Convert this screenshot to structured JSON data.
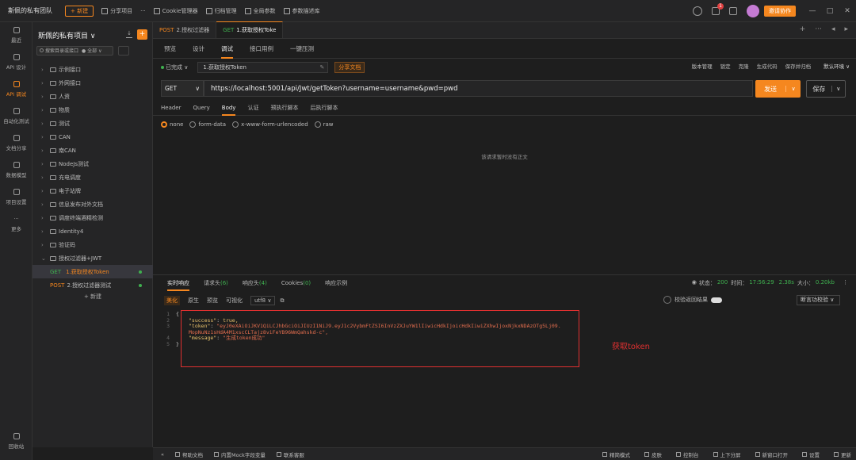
{
  "topbar": {
    "team": "斯佩的私有团队",
    "new_button": "+ 新建",
    "share_project": "分享项目",
    "more": "···",
    "cookie_manager": "Cookie管理器",
    "archive": "归档管理",
    "global_params": "全局参数",
    "param_library": "参数描述库",
    "badge_count": "1",
    "collab": "邀请协作",
    "win_min": "—",
    "win_max": "□",
    "win_close": "✕"
  },
  "rail": [
    {
      "label": "最近",
      "icon": "clock-icon"
    },
    {
      "label": "API 设计",
      "icon": "api-design-icon"
    },
    {
      "label": "API 调试",
      "icon": "api-debug-icon",
      "active": true
    },
    {
      "label": "自动化测试",
      "icon": "automation-icon"
    },
    {
      "label": "文档分享",
      "icon": "doc-share-icon"
    },
    {
      "label": "数据模型",
      "icon": "data-model-icon"
    },
    {
      "label": "项目设置",
      "icon": "settings-icon"
    },
    {
      "label": "更多",
      "icon": "more-icon"
    }
  ],
  "rail_bottom": "回收站",
  "sidebar": {
    "project_title": "斯佩的私有项目 ∨",
    "search_placeholder": "搜索目录或接口",
    "filter": "● 全部 ∨",
    "tree": [
      {
        "label": "示例接口",
        "expanded": false
      },
      {
        "label": "外网接口",
        "expanded": false
      },
      {
        "label": "人资",
        "expanded": false
      },
      {
        "label": "物质",
        "expanded": false
      },
      {
        "label": "测试",
        "expanded": false
      },
      {
        "label": "CAN",
        "expanded": false
      },
      {
        "label": "南CAN",
        "expanded": false
      },
      {
        "label": "NodeJs测试",
        "expanded": false
      },
      {
        "label": "充电调度",
        "expanded": false
      },
      {
        "label": "电子站牌",
        "expanded": false
      },
      {
        "label": "信息发布对外文档",
        "expanded": false
      },
      {
        "label": "调度终端酒精检测",
        "expanded": false
      },
      {
        "label": "Identity4",
        "expanded": false
      },
      {
        "label": "验证码",
        "expanded": false
      },
      {
        "label": "授权过滤器+JWT",
        "expanded": true
      }
    ],
    "children": [
      {
        "method": "GET",
        "label": "1.获取授权Token",
        "active": true
      },
      {
        "method": "POST",
        "label": "2.授权过滤器测试",
        "active": false
      }
    ],
    "add_label": "+ 新建"
  },
  "doc_tabs": [
    {
      "method": "POST",
      "label": "2.授权过滤器",
      "active": false
    },
    {
      "method": "GET",
      "label": "1.获取授权Toke",
      "active": true
    }
  ],
  "tabs_right": {
    "add": "+",
    "more": "···",
    "prev": "◂",
    "next": "▸"
  },
  "subtabs": [
    "预览",
    "设计",
    "调试",
    "接口用例",
    "一键压测"
  ],
  "active_subtab": 2,
  "env_row": {
    "status": "已完成 ∨",
    "name": "1.获取授权Token",
    "share_doc": "分享文档",
    "actions": [
      "版本管理",
      "锁定",
      "克隆",
      "生成代码",
      "保存并归档",
      "默认环境 ∨"
    ]
  },
  "request": {
    "method": "GET",
    "url": "https://localhost:5001/api/Jwt/getToken?username=username&pwd=pwd",
    "send": "发送",
    "save": "保存"
  },
  "req_tabs": [
    "Header",
    "Query",
    "Body",
    "认证",
    "预执行脚本",
    "后执行脚本"
  ],
  "active_req_tab": 2,
  "body_types": [
    "none",
    "form-data",
    "x-www-form-urlencoded",
    "raw"
  ],
  "active_body_type": 0,
  "no_body_text": "该请求暂时没有正文",
  "response": {
    "tabs": [
      {
        "label": "实时响应",
        "count": ""
      },
      {
        "label": "请求头",
        "count": "(6)"
      },
      {
        "label": "响应头",
        "count": "(4)"
      },
      {
        "label": "Cookies",
        "count": "(0)"
      },
      {
        "label": "响应示例",
        "count": ""
      }
    ],
    "status_label": "状态：",
    "status_code": "200",
    "time_label": "时间：",
    "time_value": "17:56:29",
    "duration": "2.38s",
    "size_label": "大小：",
    "size_value": "0.20kb",
    "formats": [
      "美化",
      "原生",
      "预览",
      "可视化"
    ],
    "encoding": "utf8 ∨",
    "verify_label": "校验返回结果",
    "assert_select": "断言功校验 ∨",
    "code": [
      {
        "ln": "1",
        "text": "{"
      },
      {
        "ln": "2",
        "key": "\"success\"",
        "val": "true,",
        "val_type": "bool"
      },
      {
        "ln": "3",
        "key": "\"token\"",
        "val": "\"eyJ0eXAiOiJKV1QiLCJhbGciOiJIUzI1NiJ9.eyJ1c2VybmFtZSI6InVzZXJuYW1lIiwicHdkIjoicHdkIiwiZXhwIjoxNjkxNDAzOTg5Lj09.",
        "val_type": "str"
      },
      {
        "ln": "",
        "val": "MopNuNz1sHdA4M1xscCLTajz8viFeYB96WmQahskd-c\",",
        "val_type": "str"
      },
      {
        "ln": "4",
        "key": "\"message\"",
        "val": "\"生成token成功\"",
        "val_type": "str"
      },
      {
        "ln": "5",
        "text": "}"
      }
    ],
    "annotation": "获取token"
  },
  "statusbar": {
    "left": [
      "帮助文档",
      "内置Mock字段变量",
      "联系客服"
    ],
    "right": [
      "精简模式",
      "皮肤",
      "控制台",
      "上下分屏",
      "新窗口打开",
      "设置",
      "更新"
    ]
  }
}
